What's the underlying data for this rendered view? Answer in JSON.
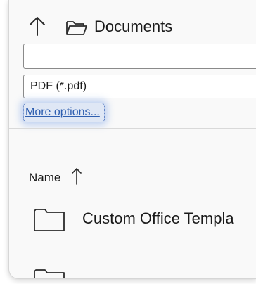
{
  "nav": {
    "location_label": "Documents"
  },
  "filename": {
    "value": "",
    "placeholder": ""
  },
  "file_type": {
    "selected": "PDF (*.pdf)"
  },
  "more_options": {
    "label": "More options..."
  },
  "list": {
    "column_name": "Name",
    "items": [
      {
        "label": "Custom Office Templa"
      },
      {
        "label": ""
      }
    ]
  },
  "icons": {
    "up": "up-arrow-icon",
    "location": "folder-open-icon",
    "sort": "sort-ascending-icon",
    "folder": "folder-icon"
  }
}
